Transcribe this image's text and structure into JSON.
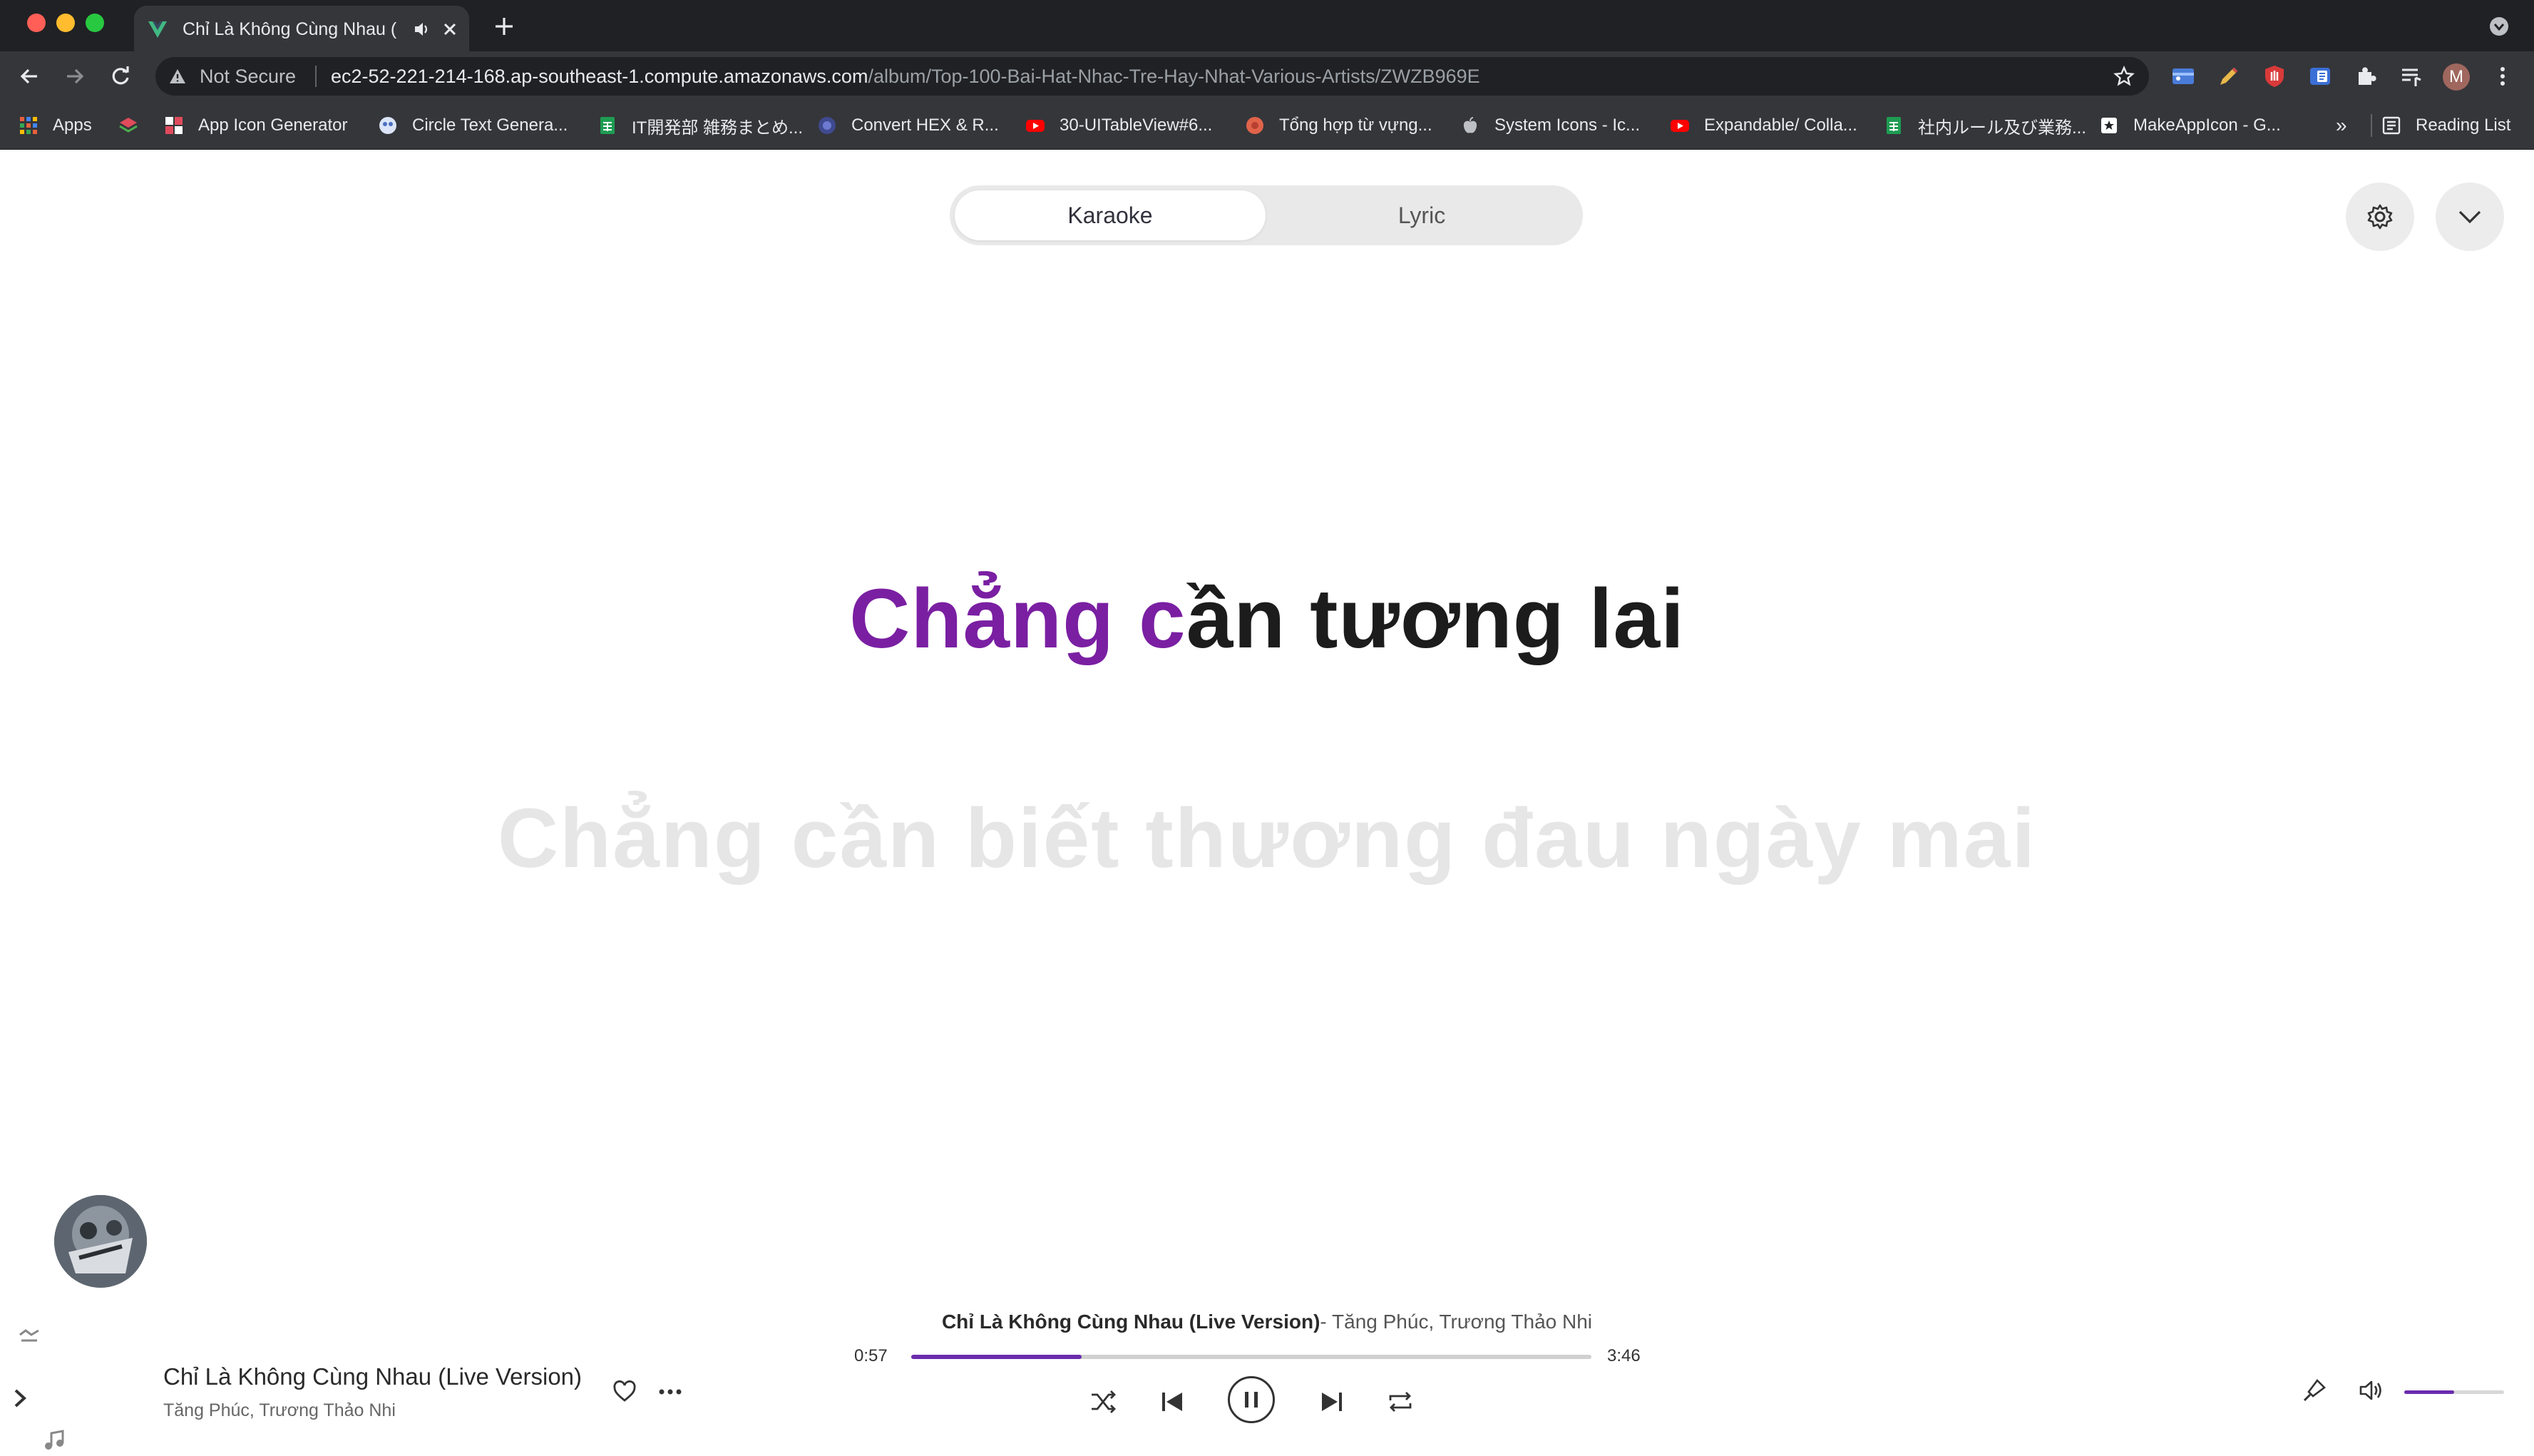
{
  "browser": {
    "tab_title": "Chỉ Là Không Cùng Nhau (",
    "omnibox": {
      "security_label": "Not Secure",
      "url_host": "ec2-52-221-214-168.ap-southeast-1.compute.amazonaws.com",
      "url_path": "/album/Top-100-Bai-Hat-Nhac-Tre-Hay-Nhat-Various-Artists/ZWZB969E"
    },
    "bookmarks": [
      {
        "label": "Apps",
        "icon": "apps-grid-icon"
      },
      {
        "label": "",
        "icon": "layers-icon"
      },
      {
        "label": "App Icon Generator",
        "icon": "app-icon-generator-icon"
      },
      {
        "label": "Circle Text Genera...",
        "icon": "circle-text-icon"
      },
      {
        "label": "IT開発部 雑務まとめ...",
        "icon": "sheets-icon"
      },
      {
        "label": "Convert HEX & R...",
        "icon": "globe-icon"
      },
      {
        "label": "30-UITableView#6...",
        "icon": "youtube-icon"
      },
      {
        "label": "Tổng hợp từ vựng...",
        "icon": "site-icon"
      },
      {
        "label": "System Icons - Ic...",
        "icon": "apple-icon"
      },
      {
        "label": "Expandable/ Colla...",
        "icon": "youtube-icon"
      },
      {
        "label": "社内ルール及び業務...",
        "icon": "sheets-icon"
      },
      {
        "label": "MakeAppIcon - G...",
        "icon": "makeappicon-icon"
      }
    ],
    "overflow_label": "»",
    "reading_list_label": "Reading List",
    "profile_initial": "M"
  },
  "app": {
    "tabs": [
      {
        "label": "Karaoke",
        "active": true
      },
      {
        "label": "Lyric",
        "active": false
      }
    ],
    "lyrics": {
      "current_sung": "Chẳng c",
      "current_rest": "ần tương lai",
      "next": "Chẳng cần biết thương đau ngày mai"
    }
  },
  "player": {
    "song_title": "Chỉ Là Không Cùng Nhau (Live Version)",
    "artists": "Tăng Phúc, Trương Thảo Nhi",
    "now_playing_title": "Chỉ Là Không Cùng Nhau (Live Version)",
    "now_playing_artists": "- Tăng Phúc, Trương Thảo Nhi",
    "elapsed": "0:57",
    "duration": "3:46",
    "progress_fraction": 0.25,
    "volume_fraction": 0.5
  },
  "colors": {
    "accent": "#7a1fa2",
    "progress": "#6b2cae",
    "chrome_dark": "#202124",
    "chrome_toolbar": "#35363a"
  }
}
